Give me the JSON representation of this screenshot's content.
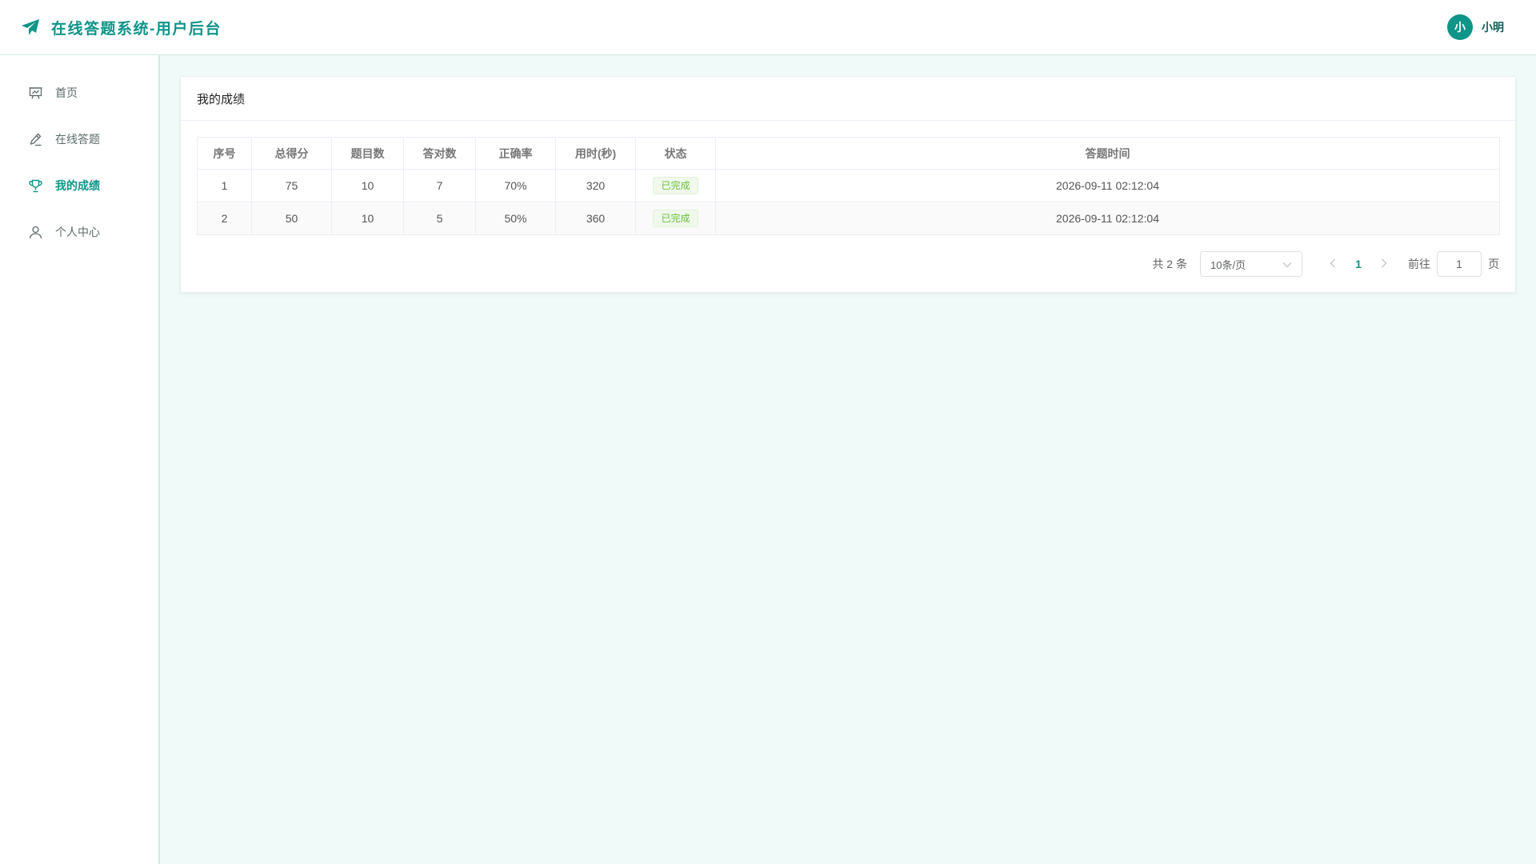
{
  "app": {
    "title": "在线答题系统-用户后台",
    "brand_icon": "paper-plane-icon",
    "accent_color": "#0f9488"
  },
  "user": {
    "avatar_initial": "小",
    "name": "小明"
  },
  "sidebar": {
    "items": [
      {
        "label": "首页",
        "icon": "presentation-board-icon",
        "active": false
      },
      {
        "label": "在线答题",
        "icon": "pencil-icon",
        "active": false
      },
      {
        "label": "我的成绩",
        "icon": "trophy-icon",
        "active": true
      },
      {
        "label": "个人中心",
        "icon": "user-icon",
        "active": false
      }
    ]
  },
  "card": {
    "title": "我的成绩"
  },
  "table": {
    "columns": [
      "序号",
      "总得分",
      "题目数",
      "答对数",
      "正确率",
      "用时(秒)",
      "状态",
      "答题时间"
    ],
    "rows": [
      {
        "index": "1",
        "score": "75",
        "total": "10",
        "correct": "7",
        "rate": "70%",
        "time": "320",
        "status": "已完成",
        "submitted_at": "2026-09-11 02:12:04"
      },
      {
        "index": "2",
        "score": "50",
        "total": "10",
        "correct": "5",
        "rate": "50%",
        "time": "360",
        "status": "已完成",
        "submitted_at": "2026-09-11 02:12:04"
      }
    ],
    "status_color": "#67c23a"
  },
  "pagination": {
    "total_text": "共 2 条",
    "page_size": "10条/页",
    "current_page": "1",
    "goto_label": "前往",
    "goto_value": "1",
    "page_suffix": "页"
  }
}
